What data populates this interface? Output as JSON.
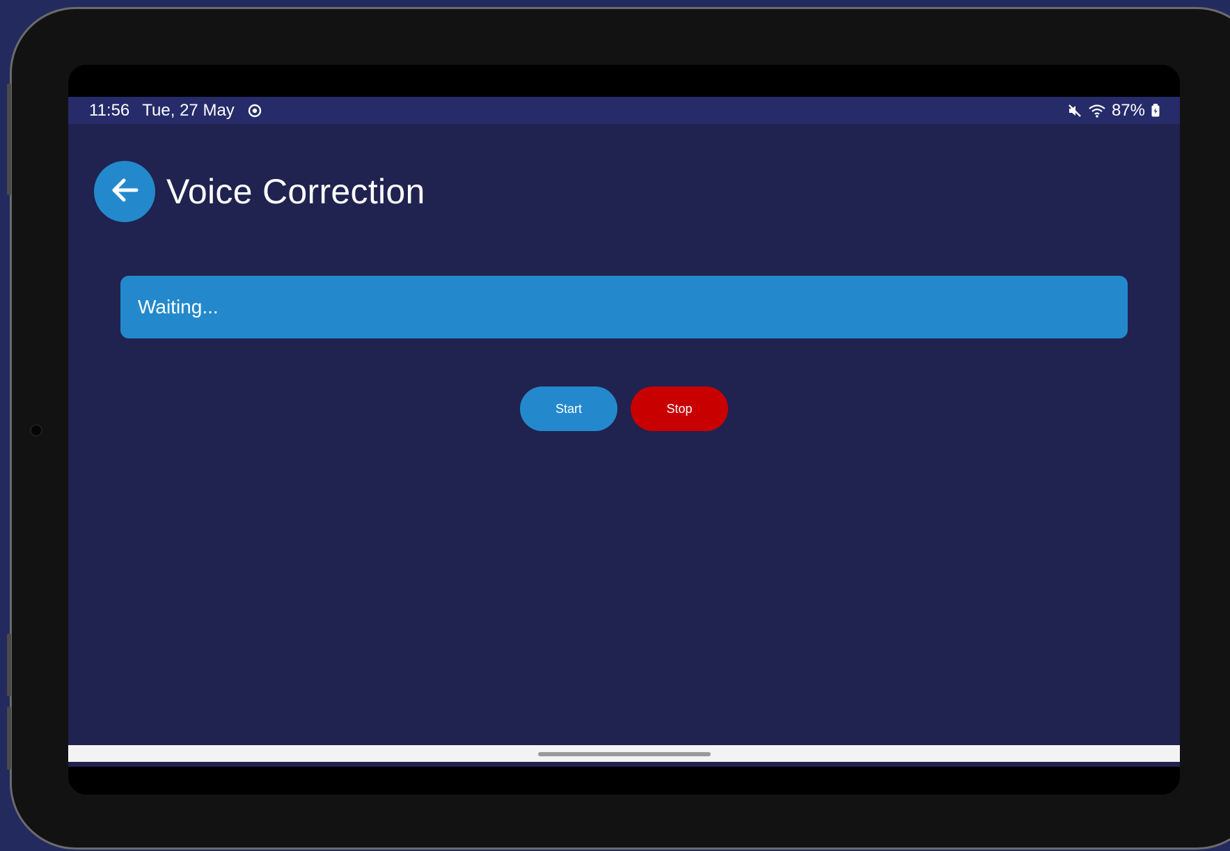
{
  "status_bar": {
    "time": "11:56",
    "date": "Tue, 27 May",
    "sync_icon": "sync-icon",
    "mute_icon": "mute-icon",
    "wifi_icon": "wifi-icon",
    "battery_percent": "87%",
    "battery_icon": "battery-icon"
  },
  "header": {
    "back_icon": "arrow-left-icon",
    "title": "Voice Correction"
  },
  "main": {
    "status_text": "Waiting..."
  },
  "controls": {
    "start_label": "Start",
    "stop_label": "Stop"
  },
  "colors": {
    "background": "#20224f",
    "status_bar": "#262b6a",
    "accent_blue": "#2389cc",
    "stop_red": "#c90000"
  }
}
